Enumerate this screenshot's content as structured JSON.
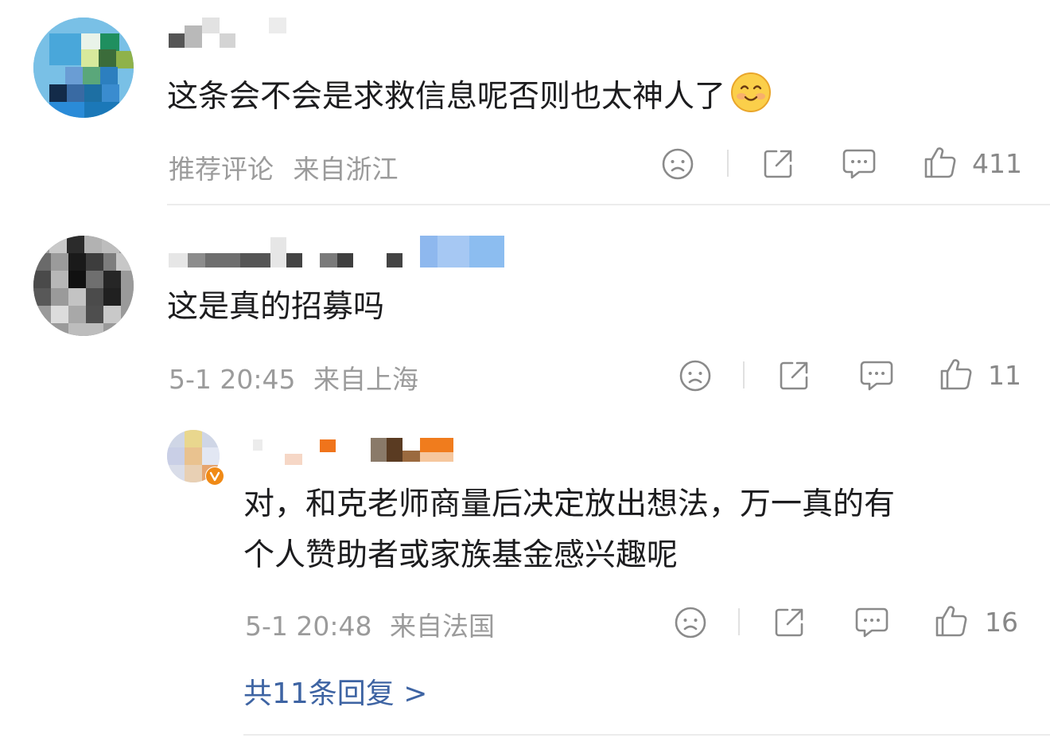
{
  "comments": [
    {
      "text": "这条会不会是求救信息呢否则也太神人了",
      "emoji": "smile-emoji",
      "tag": "推荐评论",
      "location": "来自浙江",
      "likes": "411"
    },
    {
      "text": "这是真的招募吗",
      "time": "5-1 20:45",
      "location": "来自上海",
      "likes": "11"
    }
  ],
  "reply": {
    "text_line1": "对，和克老师商量后决定放出想法，万一真的有",
    "text_line2": "个人赞助者或家族基金感兴趣呢",
    "time": "5-1 20:48",
    "location": "来自法国",
    "likes": "16",
    "badge_color": "#f08a16"
  },
  "more_replies": "共11条回复 >",
  "icons": [
    "dislike-icon",
    "share-icon",
    "comment-icon",
    "like-icon"
  ],
  "colors": {
    "link": "#3e64a3",
    "meta": "#9b9b9b"
  }
}
